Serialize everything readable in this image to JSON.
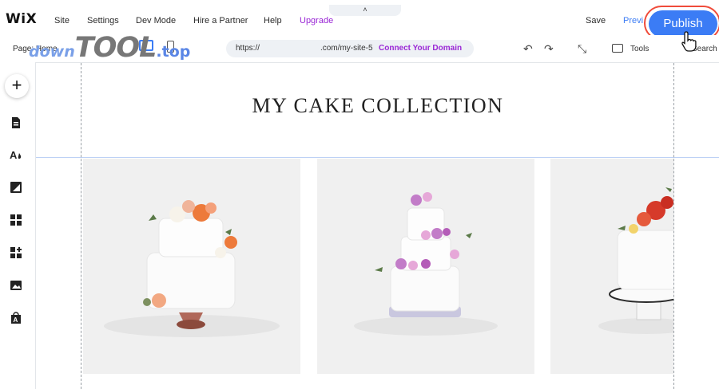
{
  "topbar": {
    "logo": "WiX",
    "menu": [
      "Site",
      "Settings",
      "Dev Mode",
      "Hire a Partner",
      "Help",
      "Upgrade"
    ],
    "collapse_glyph": "˄",
    "save": "Save",
    "preview": "Previ",
    "publish": "Publish"
  },
  "toolbar": {
    "page_label": "Page: Home",
    "watermark": {
      "part1": "down",
      "part2": "TOOL",
      "part3": ".top"
    },
    "url_prefix": "https://",
    "url_suffix": ".com/my-site-5",
    "connect_domain": "Connect Your Domain",
    "undo_icon": "↶",
    "redo_icon": "↷",
    "zoom_icon": "⤡",
    "tools": "Tools",
    "search": "Search"
  },
  "rail": {
    "add": "+",
    "icons": [
      "pages-icon",
      "design-icon",
      "background-icon",
      "add-apps-icon",
      "my-business-icon",
      "media-icon",
      "app-market-icon"
    ]
  },
  "canvas": {
    "title": "MY CAKE COLLECTION",
    "gallery": [
      "cake-image-1",
      "cake-image-2",
      "cake-image-3"
    ]
  },
  "colors": {
    "accent": "#3b7cf5",
    "upgrade": "#9a27d5",
    "publish_ring": "#f04b3a"
  }
}
